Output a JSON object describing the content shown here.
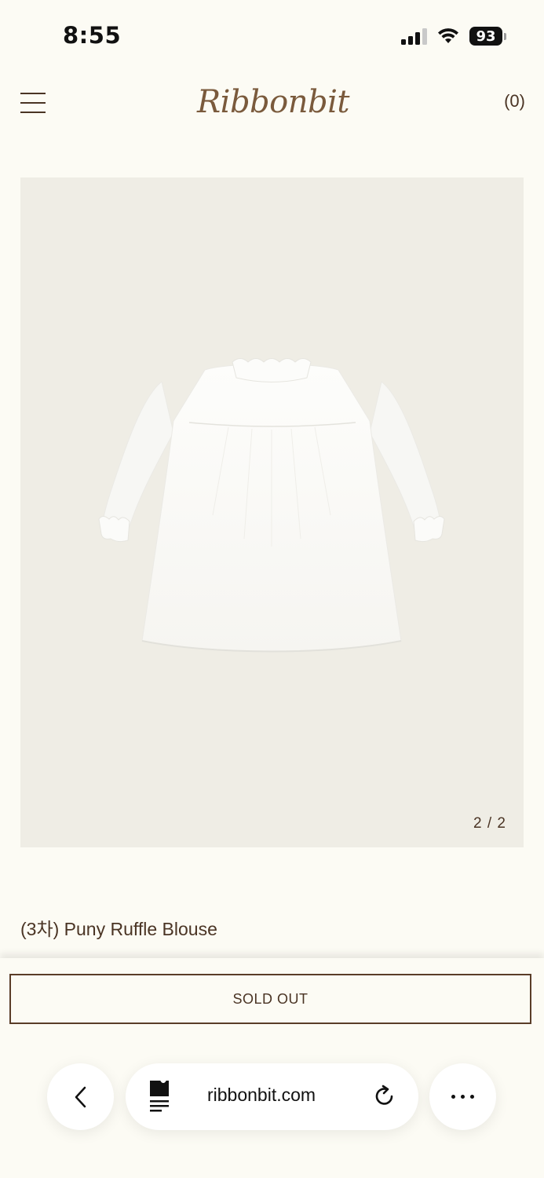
{
  "status_bar": {
    "time": "8:55",
    "battery": "93",
    "icons": [
      "cellular-signal-icon",
      "wifi-icon",
      "battery-icon"
    ]
  },
  "header": {
    "brand": "Ribbonbit",
    "cart_count_label": "(0)",
    "icons": [
      "hamburger-menu-icon"
    ]
  },
  "gallery": {
    "counter": "2 / 2",
    "background_color": "#efede5"
  },
  "product": {
    "title": "(3차) Puny Ruffle Blouse"
  },
  "purchase": {
    "button_label": "SOLD OUT"
  },
  "browser_toolbar": {
    "url": "ribbonbit.com",
    "icons": [
      "back-chevron-icon",
      "page-settings-icon",
      "reload-icon",
      "more-dots-icon"
    ]
  },
  "colors": {
    "page_background": "#fcfbf4",
    "text_brown": "#4a3424",
    "logo_brown": "#7a5a3c"
  }
}
